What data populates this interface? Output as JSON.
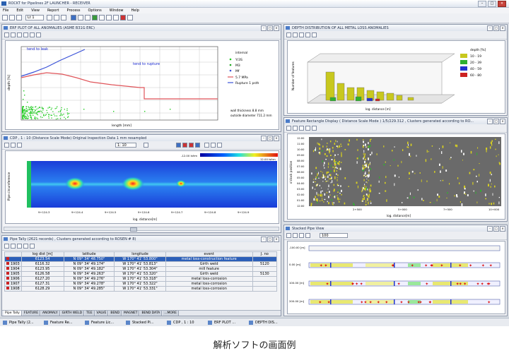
{
  "window": {
    "title": "ROCKT for Pipelines 2F LAUNCHER - RECEIVER"
  },
  "menu": [
    "File",
    "Edit",
    "View",
    "Report",
    "Process",
    "Options",
    "Window",
    "Help"
  ],
  "toolbar": {
    "combo_value": "Lt 1"
  },
  "erf_panel": {
    "title": "ERF PLOT OF ALL ANOMALIES (ASME B31G ERC)",
    "annot_left": "tend to leak",
    "annot_right": "tend to rupture",
    "xlabel": "length [mm]",
    "ylabel": "depth [%]",
    "legend": [
      "internal",
      "Y/3S",
      "M3",
      "Mf",
      "5.7 MPa",
      "Rupture 1 psth"
    ],
    "info": [
      "wall thickness  8.8 mm",
      "outside diameter  711.2 mm"
    ],
    "colors": {
      "points": "#22cc22",
      "blue_curve": "#3a52d8",
      "red_curve": "#e0555a"
    }
  },
  "depth_panel": {
    "title": "DEPTH DISTRIBUTION OF ALL METAL LOSS ANOMALIES",
    "ylabel": "Number of features",
    "xlabel": "log. distance [m]",
    "legend_title": "depth [%]",
    "legend": [
      {
        "label": "10 - 19",
        "color": "#c8c81e"
      },
      {
        "label": "20 - 39",
        "color": "#2fb02f"
      },
      {
        "label": "40 - 59",
        "color": "#2233cc"
      },
      {
        "label": "60 - 80",
        "color": "#cc2222"
      }
    ]
  },
  "cdp_panel": {
    "title": "CDP , 1 : 10  (Distance Scale Mode)  Original Inspection Data 1 mm resampled",
    "zoom_value": "1: 10",
    "ylabel": "Pipe circumference",
    "xlabel": "log. distance[m]",
    "xticks": [
      "9+124.3",
      "9+124.4",
      "9+124.5",
      "9+124.6",
      "9+124.7",
      "9+124.8",
      "9+124.9"
    ],
    "colorbar_low": "-12.00 Isfrm",
    "colorbar_high": "12.00 Isfrm"
  },
  "feature_panel": {
    "title": "Feature Rectangle Display ( Distance Scale Mode ) 1/5/229.312 , Clusters generated according to RO...",
    "ylabel": "o'clock position",
    "xlabel": "log. distance[m]",
    "yticks": [
      "12:00",
      "11:00",
      "10:00",
      "09:00",
      "08:00",
      "07:00",
      "06:00",
      "05:00",
      "04:00",
      "03:00",
      "02:00",
      "01:00",
      "12:00"
    ],
    "xticks": [
      "2+500",
      "5+000",
      "7+500",
      "10+000"
    ]
  },
  "tally_panel": {
    "title": "Pipe Tally (2621 records) , Clusters generated according to ROSEN # 8)",
    "columns": [
      "",
      "log dist [m]",
      "latitude",
      "longitude",
      "event",
      "J. no"
    ],
    "rows": [
      {
        "id": "",
        "dist": "6123.54",
        "lat": "N 09° 34' 48.750\"",
        "lon": "W 170° 41' 53.800\"",
        "event": "metal loss-construction feature",
        "jno": ""
      },
      {
        "id": "1903",
        "dist": "6116.32",
        "lat": "N 09° 34' 49.174\"",
        "lon": "W 170° 41' 53.813\"",
        "event": "Girth weld",
        "jno": "5120"
      },
      {
        "id": "1904",
        "dist": "6123.95",
        "lat": "N 09° 34' 49.182\"",
        "lon": "W 170° 41' 53.304\"",
        "event": "mill feature",
        "jno": ""
      },
      {
        "id": "1905",
        "dist": "6126.58",
        "lat": "N 09° 34' 49.263\"",
        "lon": "W 170° 41' 53.320\"",
        "event": "Girth weld",
        "jno": "5130"
      },
      {
        "id": "1906",
        "dist": "6127.20",
        "lat": "N 09° 34' 49.276\"",
        "lon": "W 170° 41' 53.318\"",
        "event": "metal loss-corrosion",
        "jno": ""
      },
      {
        "id": "1907",
        "dist": "6127.31",
        "lat": "N 09° 34' 49.278\"",
        "lon": "W 170° 41' 53.322\"",
        "event": "metal loss-corrosion",
        "jno": ""
      },
      {
        "id": "1908",
        "dist": "6128.29",
        "lat": "N 09° 34' 49.285\"",
        "lon": "W 170° 41' 53.331\"",
        "event": "metal loss-corrosion",
        "jno": ""
      }
    ],
    "sheet_tabs": [
      "Pipe Tally",
      "FEATURE",
      "ANOMALY",
      "GIRTH WELD",
      "TEE",
      "VALVE",
      "BEND",
      "MAGNET",
      "BEND DATA",
      "...MORE"
    ]
  },
  "stacked_panel": {
    "title": "Stacked Pipe View",
    "combo_value": "100",
    "rows": [
      "-100.00 [m]",
      "0.00 [m]",
      "100.00 [m]",
      "200.00 [m]"
    ]
  },
  "taskbar": [
    "Pipe Tally (2...",
    "Feature Re...",
    "Feature Lic...",
    "Stacked Pi...",
    "CDP , 1 : 10",
    "ERF PLOT ...",
    "DEPTH DIS..."
  ],
  "caption": "解析ソフトの画面例"
}
